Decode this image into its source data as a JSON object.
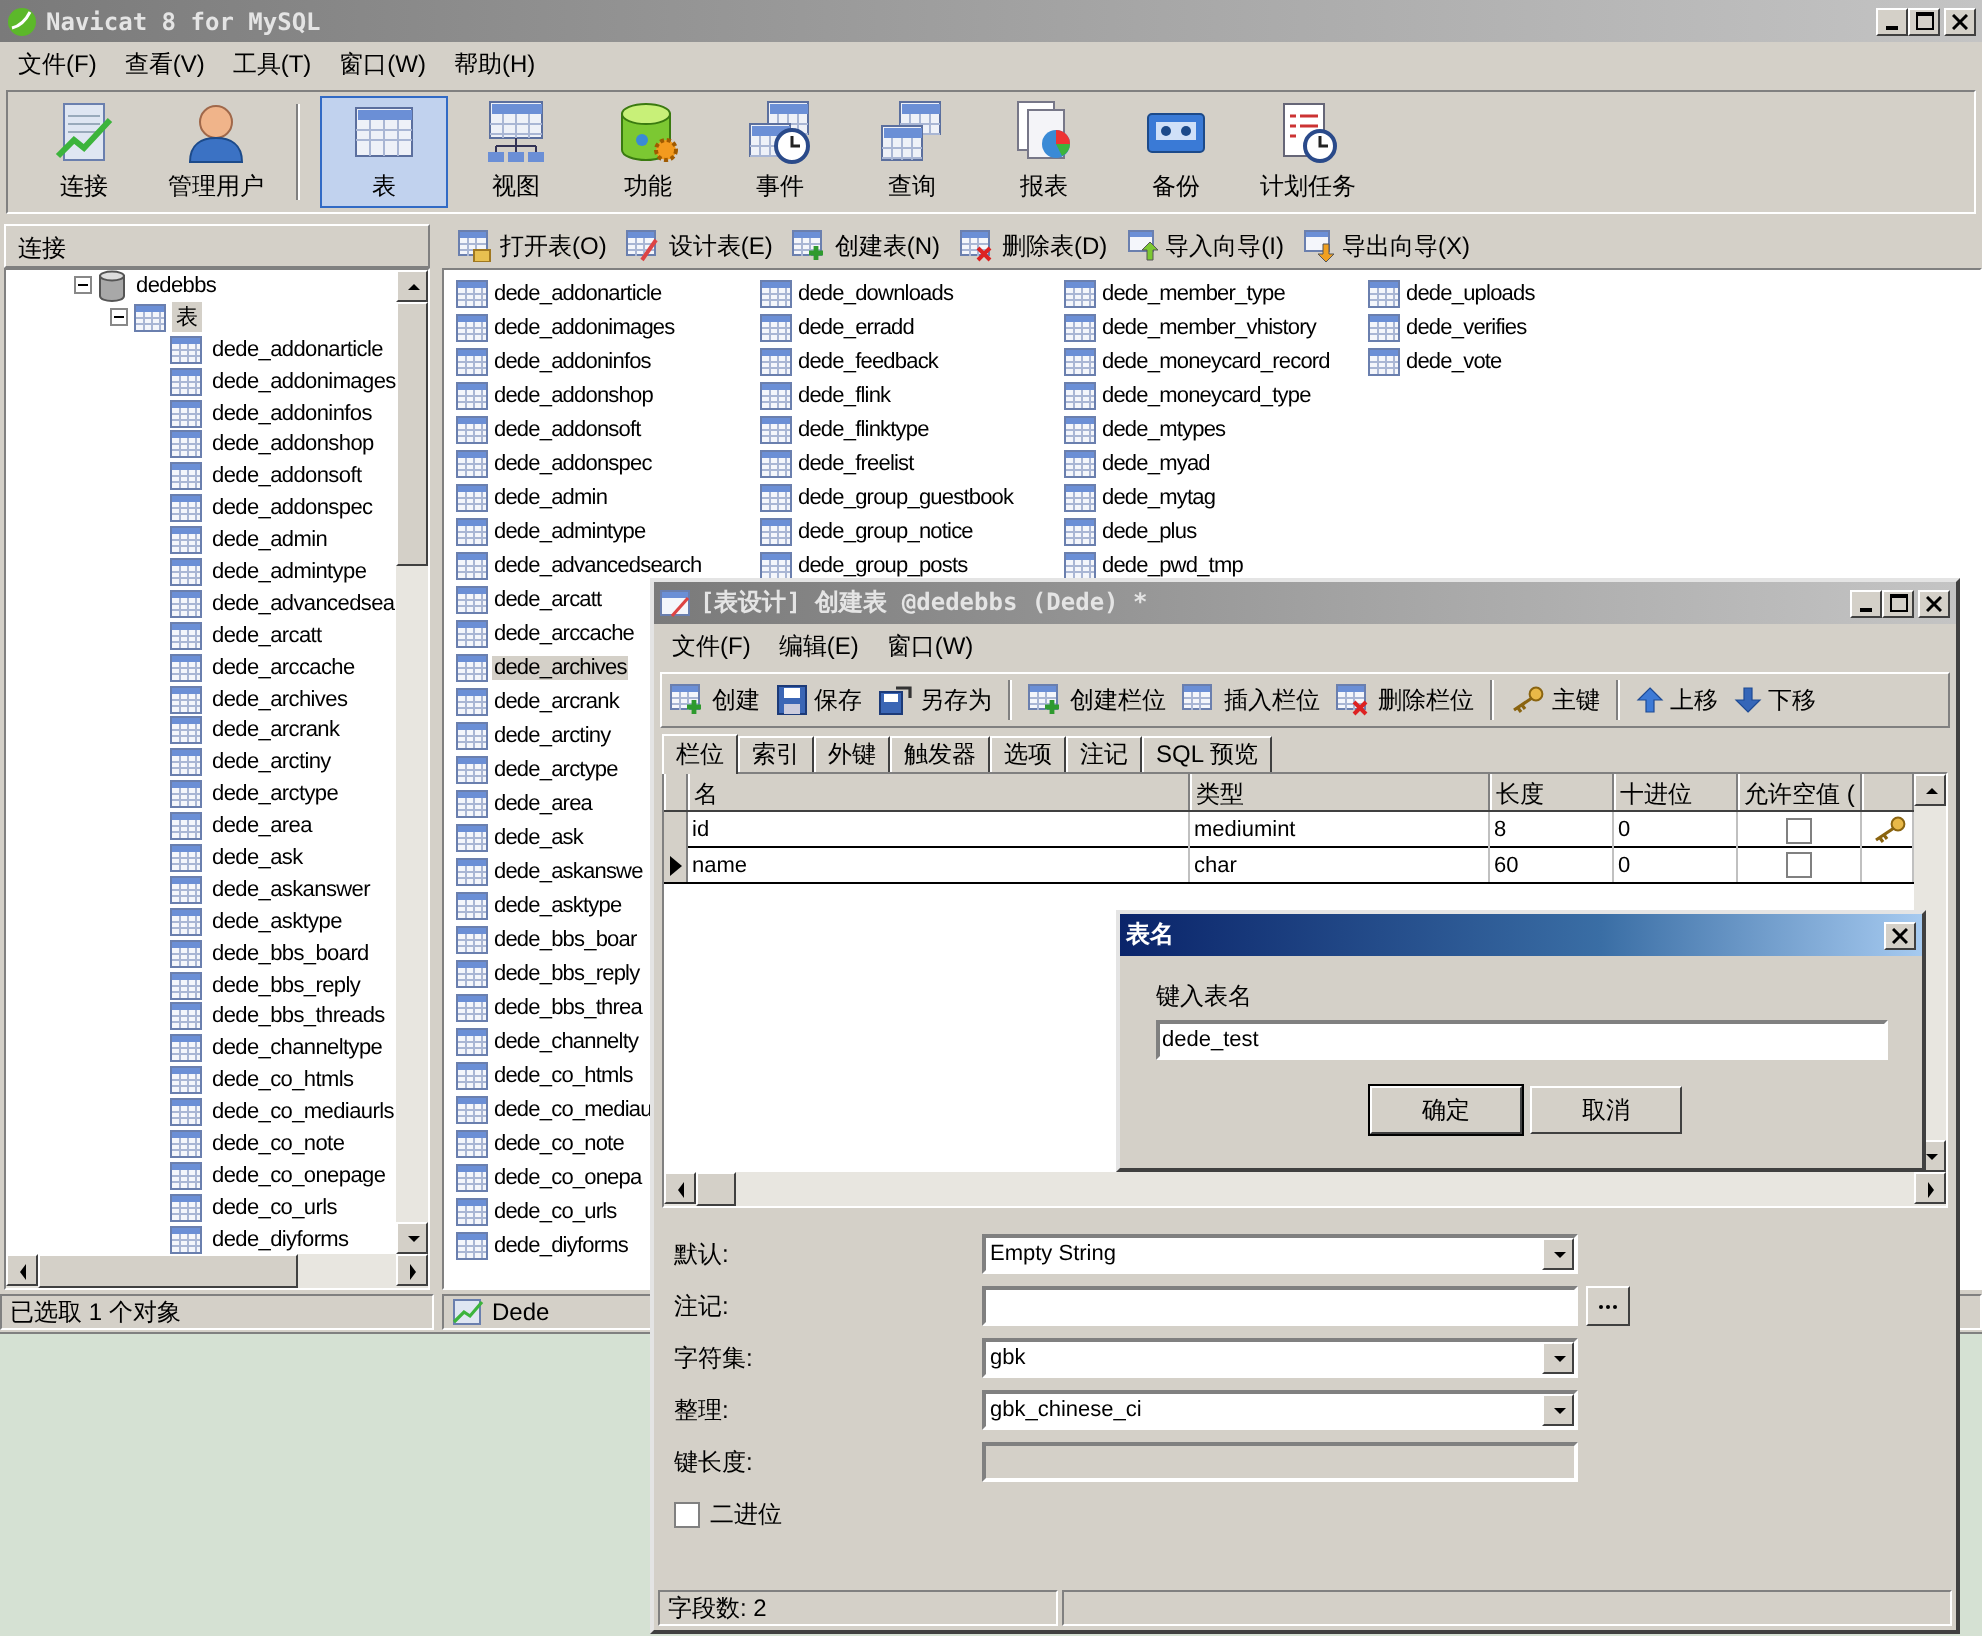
{
  "window": {
    "title": "Navicat 8 for MySQL"
  },
  "menu": [
    "文件(F)",
    "查看(V)",
    "工具(T)",
    "窗口(W)",
    "帮助(H)"
  ],
  "toolbar": {
    "connection_tools": [
      {
        "label": "连接",
        "selected": false
      },
      {
        "label": "管理用户",
        "selected": false
      }
    ],
    "object_tools": [
      {
        "label": "表",
        "selected": true
      },
      {
        "label": "视图",
        "selected": false
      },
      {
        "label": "功能",
        "selected": false
      },
      {
        "label": "事件",
        "selected": false
      },
      {
        "label": "查询",
        "selected": false
      },
      {
        "label": "报表",
        "selected": false
      },
      {
        "label": "备份",
        "selected": false
      },
      {
        "label": "计划任务",
        "selected": false
      }
    ]
  },
  "sidebar": {
    "header": "连接",
    "tree": [
      {
        "label": "dedebbs",
        "expanded": true,
        "selected": false,
        "children": [
          {
            "label": "表",
            "expanded": true,
            "selected": true,
            "children": [
              {
                "label": "dede_addonarticle"
              },
              {
                "label": "dede_addonimages"
              },
              {
                "label": "dede_addoninfos"
              },
              {
                "label": "dede_addonshop"
              },
              {
                "label": "dede_addonsoft"
              },
              {
                "label": "dede_addonspec"
              },
              {
                "label": "dede_admin"
              },
              {
                "label": "dede_admintype"
              },
              {
                "label": "dede_advancedsea"
              },
              {
                "label": "dede_arcatt"
              },
              {
                "label": "dede_arccache"
              },
              {
                "label": "dede_archives"
              },
              {
                "label": "dede_arcrank"
              },
              {
                "label": "dede_arctiny"
              },
              {
                "label": "dede_arctype"
              },
              {
                "label": "dede_area"
              },
              {
                "label": "dede_ask"
              },
              {
                "label": "dede_askanswer"
              },
              {
                "label": "dede_asktype"
              },
              {
                "label": "dede_bbs_board"
              },
              {
                "label": "dede_bbs_reply"
              },
              {
                "label": "dede_bbs_threads"
              },
              {
                "label": "dede_channeltype"
              },
              {
                "label": "dede_co_htmls"
              },
              {
                "label": "dede_co_mediaurls"
              },
              {
                "label": "dede_co_note"
              },
              {
                "label": "dede_co_onepage"
              },
              {
                "label": "dede_co_urls"
              },
              {
                "label": "dede_diyforms"
              }
            ]
          }
        ]
      }
    ]
  },
  "object_toolbar": [
    "打开表(O)",
    "设计表(E)",
    "创建表(N)",
    "删除表(D)",
    "导入向导(I)",
    "导出向导(X)"
  ],
  "object_list": {
    "columns": [
      [
        {
          "label": "dede_addonarticle",
          "selected": false
        },
        {
          "label": "dede_addonimages",
          "selected": false
        },
        {
          "label": "dede_addoninfos",
          "selected": false
        },
        {
          "label": "dede_addonshop",
          "selected": false
        },
        {
          "label": "dede_addonsoft",
          "selected": false
        },
        {
          "label": "dede_addonspec",
          "selected": false
        },
        {
          "label": "dede_admin",
          "selected": false
        },
        {
          "label": "dede_admintype",
          "selected": false
        },
        {
          "label": "dede_advancedsearch",
          "selected": false
        },
        {
          "label": "dede_arcatt",
          "selected": false
        },
        {
          "label": "dede_arccache",
          "selected": false
        },
        {
          "label": "dede_archives",
          "selected": true
        },
        {
          "label": "dede_arcrank",
          "selected": false
        },
        {
          "label": "dede_arctiny",
          "selected": false
        },
        {
          "label": "dede_arctype",
          "selected": false
        },
        {
          "label": "dede_area",
          "selected": false
        },
        {
          "label": "dede_ask",
          "selected": false
        },
        {
          "label": "dede_askanswe",
          "selected": false
        },
        {
          "label": "dede_asktype",
          "selected": false
        },
        {
          "label": "dede_bbs_boar",
          "selected": false
        },
        {
          "label": "dede_bbs_reply",
          "selected": false
        },
        {
          "label": "dede_bbs_threa",
          "selected": false
        },
        {
          "label": "dede_channelty",
          "selected": false
        },
        {
          "label": "dede_co_htmls",
          "selected": false
        },
        {
          "label": "dede_co_mediau",
          "selected": false
        },
        {
          "label": "dede_co_note",
          "selected": false
        },
        {
          "label": "dede_co_onepa",
          "selected": false
        },
        {
          "label": "dede_co_urls",
          "selected": false
        },
        {
          "label": "dede_diyforms",
          "selected": false
        }
      ],
      [
        {
          "label": "dede_downloads",
          "selected": false
        },
        {
          "label": "dede_erradd",
          "selected": false
        },
        {
          "label": "dede_feedback",
          "selected": false
        },
        {
          "label": "dede_flink",
          "selected": false
        },
        {
          "label": "dede_flinktype",
          "selected": false
        },
        {
          "label": "dede_freelist",
          "selected": false
        },
        {
          "label": "dede_group_guestbook",
          "selected": false
        },
        {
          "label": "dede_group_notice",
          "selected": false
        },
        {
          "label": "dede_group_posts",
          "selected": false
        }
      ],
      [
        {
          "label": "dede_member_type",
          "selected": false
        },
        {
          "label": "dede_member_vhistory",
          "selected": false
        },
        {
          "label": "dede_moneycard_record",
          "selected": false
        },
        {
          "label": "dede_moneycard_type",
          "selected": false
        },
        {
          "label": "dede_mtypes",
          "selected": false
        },
        {
          "label": "dede_myad",
          "selected": false
        },
        {
          "label": "dede_mytag",
          "selected": false
        },
        {
          "label": "dede_plus",
          "selected": false
        },
        {
          "label": "dede_pwd_tmp",
          "selected": false
        }
      ],
      [
        {
          "label": "dede_uploads",
          "selected": false
        },
        {
          "label": "dede_verifies",
          "selected": false
        },
        {
          "label": "dede_vote",
          "selected": false
        }
      ]
    ]
  },
  "status_bar": {
    "left": "已选取 1 个对象",
    "right": "Dede"
  },
  "design_window": {
    "title": "[表设计] 创建表 @dedebbs (Dede) *",
    "menu": [
      "文件(F)",
      "编辑(E)",
      "窗口(W)"
    ],
    "toolbar": [
      [
        "创建",
        "保存",
        "另存为"
      ],
      [
        "创建栏位",
        "插入栏位",
        "删除栏位"
      ],
      [
        "主键"
      ],
      [
        "上移",
        "下移"
      ]
    ],
    "tabs": [
      {
        "label": "栏位",
        "selected": true
      },
      {
        "label": "索引",
        "selected": false
      },
      {
        "label": "外键",
        "selected": false
      },
      {
        "label": "触发器",
        "selected": false
      },
      {
        "label": "选项",
        "selected": false
      },
      {
        "label": "注记",
        "selected": false
      },
      {
        "label": "SQL 预览",
        "selected": false
      }
    ],
    "table": {
      "columns": [
        "名",
        "类型",
        "长度",
        "十进位",
        "允许空值 ("
      ],
      "rows": [
        {
          "cells": [
            "id",
            "mediumint",
            "8",
            "0"
          ],
          "allow_null": false,
          "primary_key": true,
          "current": false
        },
        {
          "cells": [
            "name",
            "char",
            "60",
            "0"
          ],
          "allow_null": false,
          "primary_key": false,
          "current": true
        }
      ]
    },
    "properties": [
      {
        "kind": "select",
        "label": "默认:",
        "value": "Empty String"
      },
      {
        "kind": "text_button",
        "label": "注记:"
      },
      {
        "kind": "select",
        "label": "字符集:",
        "value": "gbk"
      },
      {
        "kind": "select",
        "label": "整理:",
        "value": "gbk_chinese_ci"
      },
      {
        "kind": "disabled_text",
        "label": "键长度:"
      }
    ],
    "binary": {
      "label": "二进位",
      "checked": false
    },
    "status": "字段数: 2"
  },
  "dialog": {
    "title": "表名",
    "prompt": "键入表名",
    "value": "dede_test",
    "buttons": [
      {
        "label": "确定",
        "default": true
      },
      {
        "label": "取消",
        "default": false
      }
    ]
  }
}
